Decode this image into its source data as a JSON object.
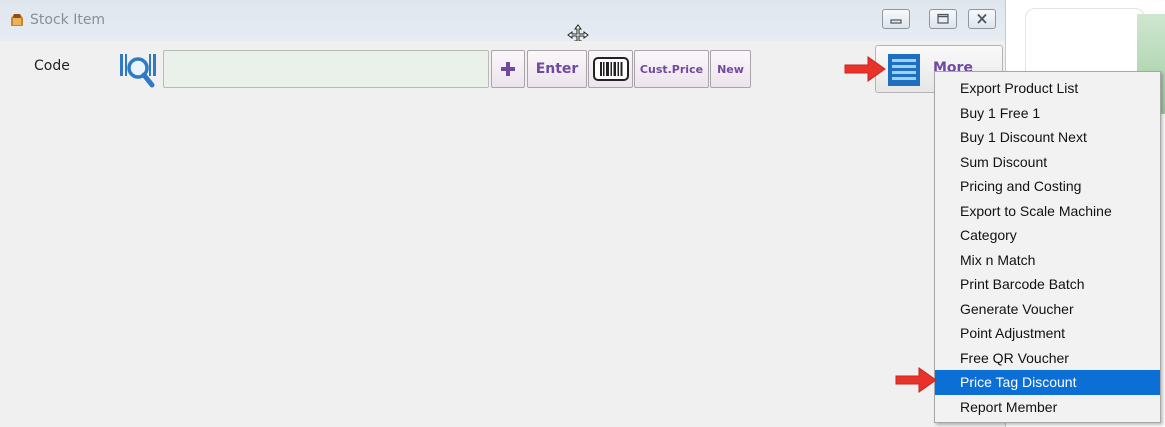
{
  "window": {
    "title": "Stock Item"
  },
  "toolbar": {
    "code_label": "Code",
    "code_value": "",
    "enter_label": "Enter",
    "cust_price_label": "Cust.Price",
    "new_label": "New",
    "more_label": "More"
  },
  "menu": {
    "items": [
      {
        "label": "Export Product List"
      },
      {
        "label": "Buy 1 Free 1"
      },
      {
        "label": "Buy 1 Discount Next"
      },
      {
        "label": "Sum Discount"
      },
      {
        "label": "Pricing and Costing"
      },
      {
        "label": "Export to Scale Machine"
      },
      {
        "label": "Category"
      },
      {
        "label": "Mix n Match"
      },
      {
        "label": "Print Barcode Batch"
      },
      {
        "label": "Generate Voucher"
      },
      {
        "label": "Point Adjustment"
      },
      {
        "label": "Free QR Voucher"
      },
      {
        "label": "Price Tag Discount",
        "selected": true
      },
      {
        "label": "Report Member"
      }
    ]
  },
  "icons": {
    "app": "stock-item-app-icon",
    "move": "move-cursor-icon",
    "minimize": "minimize-icon",
    "maximize": "maximize-icon",
    "close": "close-icon",
    "barcode_search": "barcode-search-icon",
    "plus": "plus-icon",
    "barcode": "barcode-icon",
    "more": "more-list-icon",
    "annotation_arrow": "red-arrow-icon"
  },
  "colors": {
    "button_text": "#6f4a9f",
    "menu_selected": "#0b6fd6",
    "annotation_arrow": "#e8332a"
  }
}
